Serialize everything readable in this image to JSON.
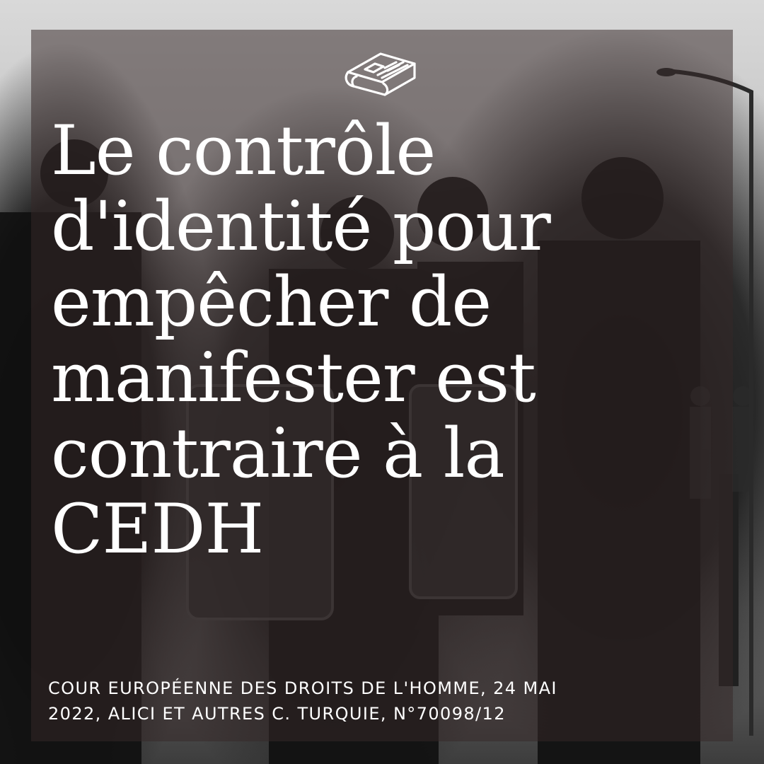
{
  "post": {
    "icon": "newspaper-icon",
    "headline_lines": [
      "Le contrôle",
      "d'identité pour",
      "empêcher de",
      "manifester est",
      "contraire à la",
      "CEDH"
    ],
    "caption_lines": [
      "COUR EUROPÉENNE DES DROITS DE L'HOMME, 24 MAI",
      "2022, ALICI ET AUTRES C. TURQUIE, N°70098/12"
    ],
    "colors": {
      "text": "#ffffff",
      "overlay": "#362828"
    }
  }
}
